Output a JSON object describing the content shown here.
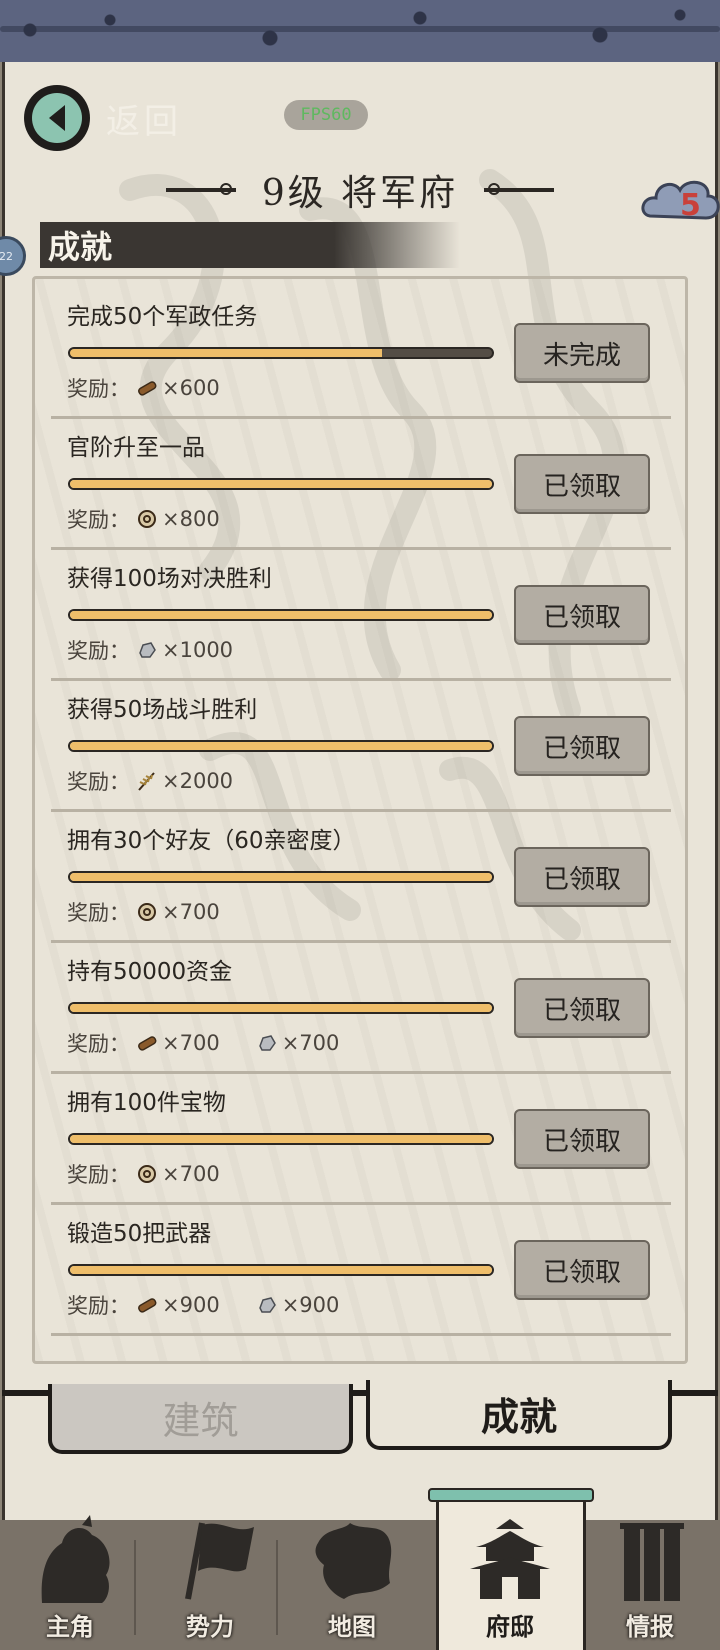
{
  "header": {
    "back_label": "返回",
    "fps": "FPS60",
    "title": "9级  将军府",
    "badge_count": "5",
    "side_tag": "22"
  },
  "section": {
    "title": "成就"
  },
  "achievements": [
    {
      "title": "完成50个军政任务",
      "progress": 0.74,
      "reward_label": "奖励：",
      "rewards": [
        {
          "icon": "wood-icon",
          "amount": "×600"
        }
      ],
      "status": "未完成"
    },
    {
      "title": "官阶升至一品",
      "progress": 1.0,
      "reward_label": "奖励：",
      "rewards": [
        {
          "icon": "coin-icon",
          "amount": "×800"
        }
      ],
      "status": "已领取"
    },
    {
      "title": "获得100场对决胜利",
      "progress": 1.0,
      "reward_label": "奖励：",
      "rewards": [
        {
          "icon": "stone-icon",
          "amount": "×1000"
        }
      ],
      "status": "已领取"
    },
    {
      "title": "获得50场战斗胜利",
      "progress": 1.0,
      "reward_label": "奖励：",
      "rewards": [
        {
          "icon": "grain-icon",
          "amount": "×2000"
        }
      ],
      "status": "已领取"
    },
    {
      "title": "拥有30个好友（60亲密度）",
      "progress": 1.0,
      "reward_label": "奖励：",
      "rewards": [
        {
          "icon": "coin-icon",
          "amount": "×700"
        }
      ],
      "status": "已领取"
    },
    {
      "title": "持有50000资金",
      "progress": 1.0,
      "reward_label": "奖励：",
      "rewards": [
        {
          "icon": "wood-icon",
          "amount": "×700"
        },
        {
          "icon": "stone-icon",
          "amount": "×700"
        }
      ],
      "status": "已领取"
    },
    {
      "title": "拥有100件宝物",
      "progress": 1.0,
      "reward_label": "奖励：",
      "rewards": [
        {
          "icon": "coin-icon",
          "amount": "×700"
        }
      ],
      "status": "已领取"
    },
    {
      "title": "锻造50把武器",
      "progress": 1.0,
      "reward_label": "奖励：",
      "rewards": [
        {
          "icon": "wood-icon",
          "amount": "×900"
        },
        {
          "icon": "stone-icon",
          "amount": "×900"
        }
      ],
      "status": "已领取"
    }
  ],
  "tabs": {
    "building": "建筑",
    "achievement": "成就",
    "active": "achievement"
  },
  "nav": [
    {
      "label": "主角",
      "icon": "hero-icon"
    },
    {
      "label": "势力",
      "icon": "flag-icon"
    },
    {
      "label": "地图",
      "icon": "map-icon"
    },
    {
      "label": "府邸",
      "icon": "mansion-icon",
      "active": true
    },
    {
      "label": "情报",
      "icon": "scroll-icon"
    }
  ],
  "colors": {
    "progress_fill": "#efbe6a",
    "paper": "#e9e4d8",
    "back_accent": "#8cc4b0",
    "badge_red": "#c9413a"
  }
}
